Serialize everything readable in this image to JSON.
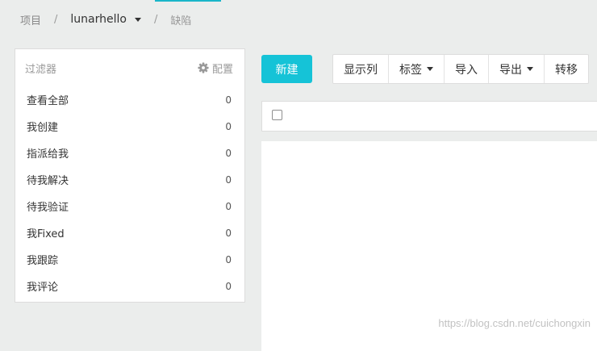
{
  "breadcrumb": {
    "root": "项目",
    "separator": "/",
    "project": "lunarhello",
    "current": "缺陷"
  },
  "sidebar": {
    "title": "过滤器",
    "config_label": "配置",
    "items": [
      {
        "label": "查看全部",
        "count": "0"
      },
      {
        "label": "我创建",
        "count": "0"
      },
      {
        "label": "指派给我",
        "count": "0"
      },
      {
        "label": "待我解决",
        "count": "0"
      },
      {
        "label": "待我验证",
        "count": "0"
      },
      {
        "label": "我Fixed",
        "count": "0"
      },
      {
        "label": "我跟踪",
        "count": "0"
      },
      {
        "label": "我评论",
        "count": "0"
      }
    ]
  },
  "toolbar": {
    "new_label": "新建",
    "show_columns_label": "显示列",
    "tags_label": "标签",
    "import_label": "导入",
    "export_label": "导出",
    "convert_label": "转移"
  },
  "watermark": "https://blog.csdn.net/cuichongxin",
  "colors": {
    "accent": "#15c3d7",
    "background": "#ebedec",
    "panel": "#ffffff"
  }
}
